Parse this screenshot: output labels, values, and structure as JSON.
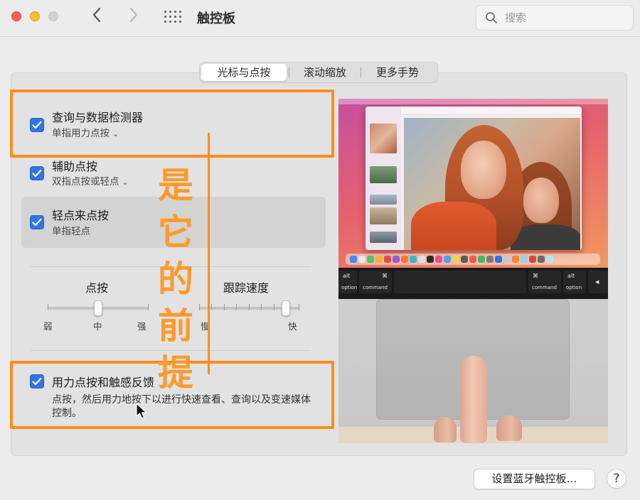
{
  "window": {
    "title": "触控板",
    "search_placeholder": "搜索"
  },
  "tabs": [
    {
      "label": "光标与点按",
      "active": true
    },
    {
      "label": "滚动缩放",
      "active": false
    },
    {
      "label": "更多手势",
      "active": false
    }
  ],
  "options": {
    "lookup": {
      "title": "查询与数据检测器",
      "subtitle": "单指用力点按",
      "checked": true
    },
    "secondary_click": {
      "title": "辅助点按",
      "subtitle": "双指点按或轻点",
      "checked": true
    },
    "tap_to_click": {
      "title": "轻点来点按",
      "subtitle": "单指轻点",
      "checked": true
    },
    "force_click": {
      "title": "用力点按和触感反馈",
      "subtitle": "点按，然后用力地按下以进行快速查看、查询以及变速媒体控制。",
      "checked": true
    }
  },
  "sliders": {
    "click": {
      "title": "点按",
      "min_label": "弱",
      "mid_label": "中",
      "max_label": "强",
      "value": 0.5
    },
    "tracking": {
      "title": "跟踪速度",
      "min_label": "慢",
      "max_label": "快",
      "value": 0.87
    }
  },
  "annotation": {
    "text": "是它的前提"
  },
  "preview": {
    "keys": {
      "alt_left": "alt",
      "option_left": "option",
      "cmd_sym": "⌘",
      "command_label": "command",
      "alt_right": "alt",
      "option_right": "option",
      "arrow": "◀"
    }
  },
  "buttons": {
    "bluetooth": "设置蓝牙触控板…",
    "help": "?"
  },
  "colors": {
    "accent": "#2f75e6",
    "annotation": "#ff8c1a"
  }
}
